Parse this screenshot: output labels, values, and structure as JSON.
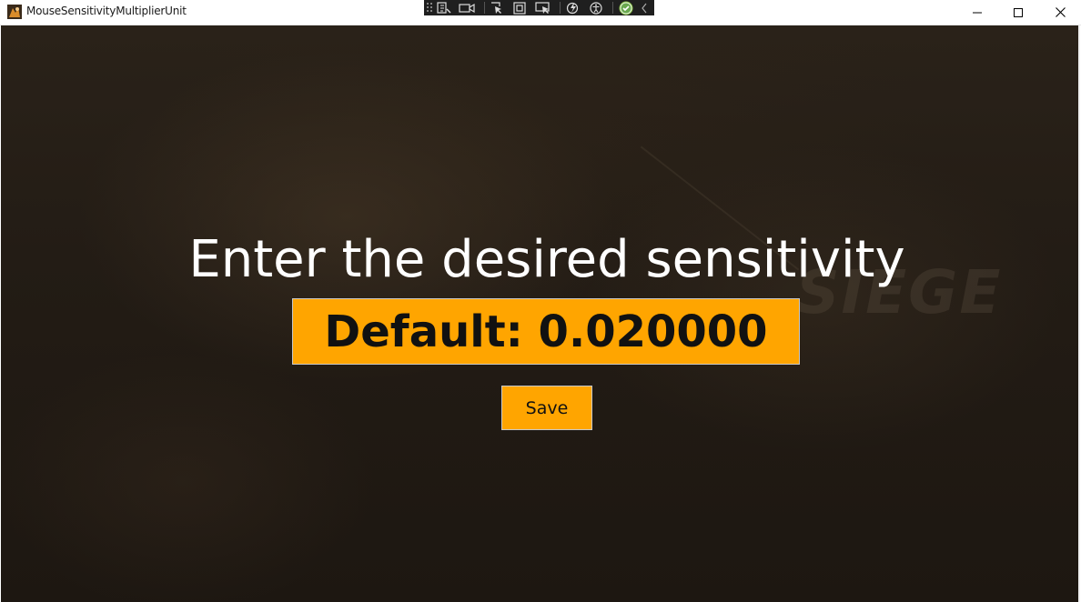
{
  "window": {
    "title": "MouseSensitivityMultiplierUnit",
    "controls": {
      "minimize_icon": "minimize-icon",
      "maximize_icon": "maximize-icon",
      "close_icon": "close-icon"
    }
  },
  "devtools_bar": {
    "icons": [
      "live-visual-tree-icon",
      "record-icon",
      "select-element-icon",
      "display-layout-adorners-icon",
      "track-focus-icon",
      "hot-reload-icon",
      "accessibility-icon",
      "binding-ok-icon",
      "collapse-icon"
    ]
  },
  "background": {
    "watermark_text": "SIEGE"
  },
  "main": {
    "heading": "Enter the desired sensitivity",
    "sensitivity_input": {
      "value": "Default: 0.020000"
    },
    "save_label": "Save"
  },
  "colors": {
    "accent": "#ffa500",
    "heading_text": "#ffffff",
    "button_text": "#111111",
    "background": "#231c15"
  }
}
